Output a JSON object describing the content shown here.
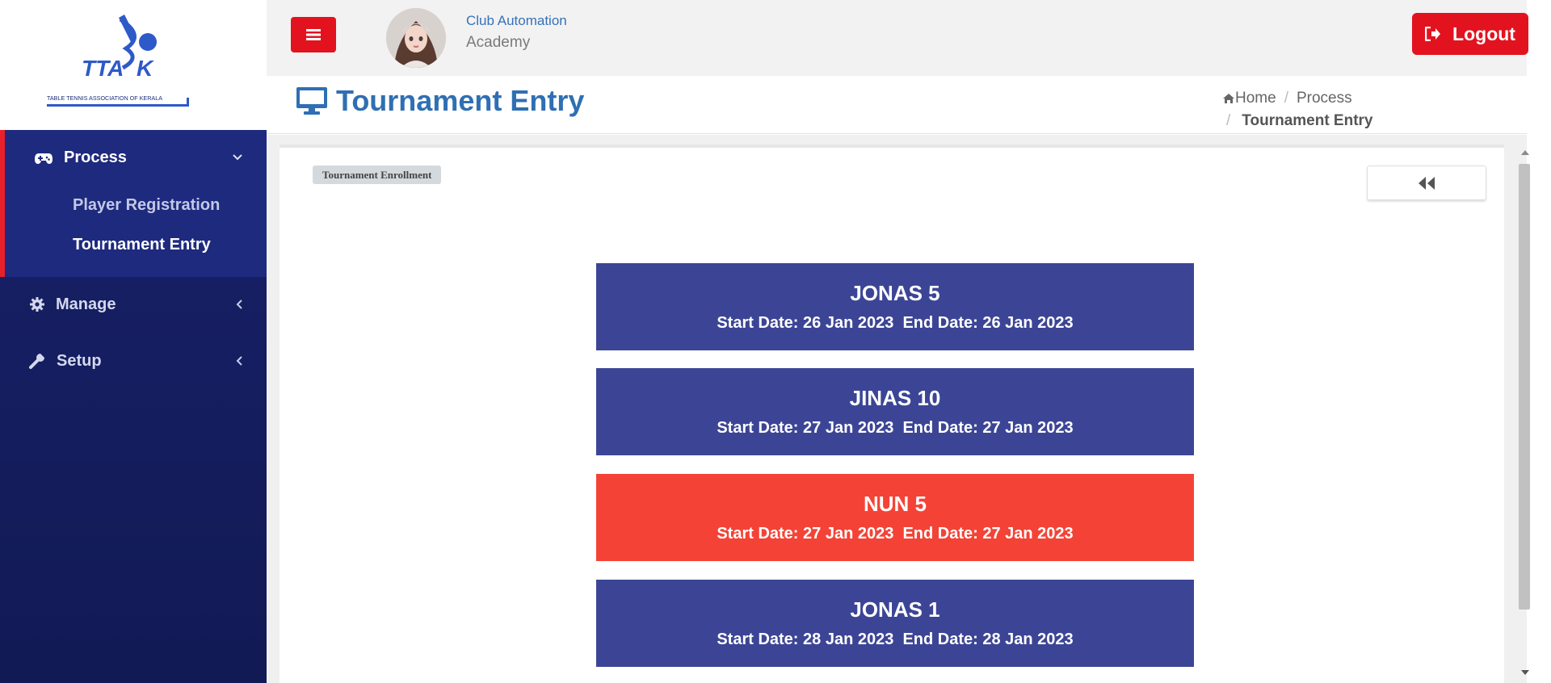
{
  "sidebar": {
    "logo_text": "TTAK",
    "logo_tagline": "TABLE TENNIS ASSOCIATION OF KERALA",
    "process": {
      "label": "Process",
      "icon": "gamepad-icon",
      "items": [
        {
          "label": "Player Registration"
        },
        {
          "label": "Tournament Entry"
        }
      ]
    },
    "manage": {
      "label": "Manage",
      "icon": "gear-icon"
    },
    "setup": {
      "label": "Setup",
      "icon": "wrench-icon"
    }
  },
  "topbar": {
    "org_name": "Club Automation",
    "org_sub": "Academy",
    "logout_label": "Logout"
  },
  "page": {
    "title": "Tournament Entry",
    "breadcrumb": {
      "home": "Home",
      "process": "Process",
      "current": "Tournament Entry"
    }
  },
  "content": {
    "badge": "Tournament Enrollment",
    "tournaments": [
      {
        "name": "JONAS 5",
        "dates": "Start Date: 26 Jan 2023  End Date: 26 Jan 2023",
        "color": "#3c4595"
      },
      {
        "name": "JINAS 10",
        "dates": "Start Date: 27 Jan 2023  End Date: 27 Jan 2023",
        "color": "#3c4595"
      },
      {
        "name": "NUN 5",
        "dates": "Start Date: 27 Jan 2023  End Date: 27 Jan 2023",
        "color": "#f44336"
      },
      {
        "name": "JONAS 1",
        "dates": "Start Date: 28 Jan 2023  End Date: 28 Jan 2023",
        "color": "#3c4595"
      }
    ]
  },
  "colors": {
    "accent_red": "#e2131f",
    "title_blue": "#2f6fb3",
    "sidebar_navy": "#161f63"
  }
}
